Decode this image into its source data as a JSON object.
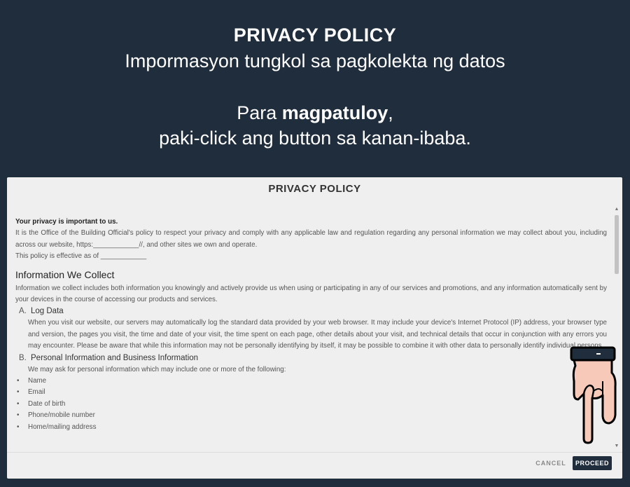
{
  "hero": {
    "title": "PRIVACY POLICY",
    "subtitle": "Impormasyon tungkol sa pagkolekta ng datos",
    "line1_prefix": "Para ",
    "line1_bold": "magpatuloy",
    "line1_suffix": ",",
    "line2": "paki-click ang button sa kanan-ibaba."
  },
  "dialog": {
    "title": "PRIVACY POLICY",
    "intro_heading": "Your privacy is important to us.",
    "intro_text": "It is the Office of the Building Official's policy to respect your privacy and comply with any applicable law and regulation regarding any personal information we may collect about you, including across our website, https:____________//, and other sites we own and operate.",
    "effective": "This policy is effective as of ____________",
    "section_heading": "Information We Collect",
    "section_text": "Information we collect includes both information you knowingly and actively provide us when using or participating in any of our services and promotions, and any information automatically sent by your devices in the course of accessing our products and services.",
    "sub_a_index": "A.",
    "sub_a_title": "Log Data",
    "sub_a_text": "When you visit our website, our servers may automatically log the standard data provided by your web browser. It may include your device's Internet Protocol (IP) address, your browser type and version, the pages you visit, the time and date of your visit, the time spent on each page, other details about your visit, and technical details that occur in conjunction with any errors you may encounter. Please be aware that while this information may not be personally identifying by itself, it may be possible to combine it with other data to personally identify individual persons.",
    "sub_b_index": "B.",
    "sub_b_title": "Personal Information and Business Information",
    "sub_b_text": "We may ask for personal information which may include one or more of the following:",
    "list": [
      "Name",
      "Email",
      "Date of birth",
      "Phone/mobile number",
      "Home/mailing address"
    ],
    "cancel_label": "CANCEL",
    "proceed_label": "PROCEED"
  },
  "colors": {
    "background": "#1f2d3d",
    "dialog": "#efefef",
    "proceed_button": "#1f2d3d",
    "hand_fill": "#f7c9b8"
  },
  "icons": {
    "pointer": "pointing-hand-icon"
  }
}
